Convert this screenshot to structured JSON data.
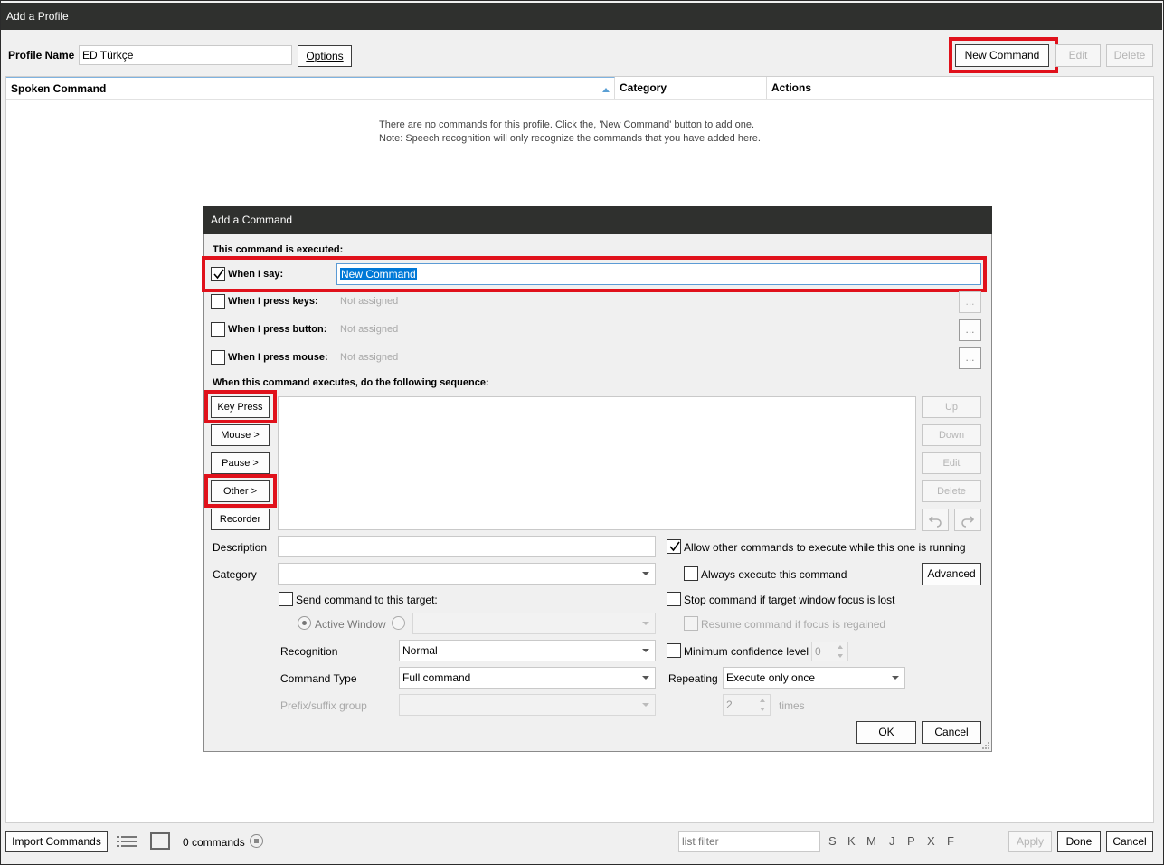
{
  "window": {
    "title": "Add a Profile",
    "profile_name_label": "Profile Name",
    "profile_name_value": "ED Türkçe",
    "options_label": "Options",
    "new_command_label": "New Command",
    "edit_label": "Edit",
    "delete_label": "Delete"
  },
  "table": {
    "columns": [
      "Spoken Command",
      "Category",
      "Actions"
    ],
    "empty_line1": "There are no commands for this profile.  Click the, 'New Command' button to add one.",
    "empty_line2": "Note:  Speech recognition will only recognize the commands that you have added here."
  },
  "dialog": {
    "title": "Add a Command",
    "executed_header": "This command is executed:",
    "when_i_say_label": "When I say:",
    "when_i_say_value": "New Command",
    "when_press_keys_label": "When I press keys:",
    "when_press_button_label": "When I press button:",
    "when_press_mouse_label": "When I press mouse:",
    "not_assigned": "Not assigned",
    "ellipsis": "...",
    "sequence_header": "When this command executes, do the following sequence:",
    "key_press": "Key Press",
    "mouse": "Mouse >",
    "pause": "Pause >",
    "other": "Other >",
    "recorder": "Recorder",
    "up": "Up",
    "down": "Down",
    "edit": "Edit",
    "delete": "Delete",
    "description_label": "Description",
    "category_label": "Category",
    "allow_other": "Allow other commands to execute while this one is running",
    "always_execute": "Always execute this command",
    "advanced": "Advanced",
    "send_command": "Send command to this target:",
    "stop_command": "Stop command if target window focus is lost",
    "active_window": "Active Window",
    "resume_command": "Resume command if focus is regained",
    "recognition_label": "Recognition",
    "recognition_value": "Normal",
    "min_confidence": "Minimum confidence level",
    "min_confidence_value": "0",
    "command_type_label": "Command Type",
    "command_type_value": "Full command",
    "repeating_label": "Repeating",
    "repeating_value": "Execute only once",
    "prefix_label": "Prefix/suffix group",
    "times_value": "2",
    "times_label": "times",
    "ok": "OK",
    "cancel": "Cancel"
  },
  "footer": {
    "import_commands": "Import Commands",
    "count": "0 commands",
    "filter_placeholder": "list filter",
    "letters": [
      "S",
      "K",
      "M",
      "J",
      "P",
      "X",
      "F"
    ],
    "apply": "Apply",
    "done": "Done",
    "cancel": "Cancel"
  },
  "colors": {
    "highlight": "#e0111b",
    "titlebar": "#2f302e",
    "selection": "#0078d7"
  }
}
